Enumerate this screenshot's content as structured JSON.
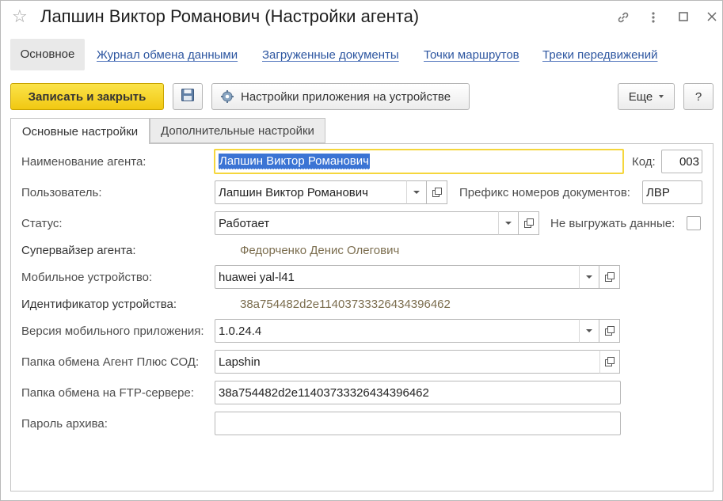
{
  "window": {
    "title": "Лапшин Виктор Романович (Настройки агента)",
    "favorite_icon": "star-icon",
    "link_icon": "link-icon",
    "more_icon": "more-vertical-icon",
    "maximize_icon": "maximize-icon",
    "close_icon": "close-icon"
  },
  "nav": {
    "items": [
      "Основное",
      "Журнал обмена данными",
      "Загруженные документы",
      "Точки маршрутов",
      "Треки передвижений"
    ]
  },
  "toolbar": {
    "save_close_label": "Записать и закрыть",
    "save_icon": "floppy-disk-icon",
    "app_settings_label": "Настройки приложения на устройстве",
    "app_settings_icon": "gear-icon",
    "more_label": "Еще",
    "help_label": "?"
  },
  "tabs": {
    "main": "Основные настройки",
    "extra": "Дополнительные настройки"
  },
  "form": {
    "agent_name_label": "Наименование агента:",
    "agent_name_value": "Лапшин Виктор Романович",
    "code_label": "Код:",
    "code_value": "003",
    "user_label": "Пользователь:",
    "user_value": "Лапшин Виктор Романович",
    "prefix_label": "Префикс номеров документов:",
    "prefix_value": "ЛВР",
    "status_label": "Статус:",
    "status_value": "Работает",
    "no_export_label": "Не выгружать данные:",
    "supervisor_label": "Супервайзер агента:",
    "supervisor_value": "Федорченко Денис Олегович",
    "device_label": "Мобильное устройство:",
    "device_value": "huawei yal-l41",
    "device_id_label": "Идентификатор устройства:",
    "device_id_value": "38a754482d2e11403733326434396462",
    "app_version_label": "Версия мобильного приложения:",
    "app_version_value": "1.0.24.4",
    "exchange_folder_label": "Папка обмена Агент Плюс СОД:",
    "exchange_folder_value": "Lapshin",
    "ftp_folder_label": "Папка обмена на FTP-сервере:",
    "ftp_folder_value": "38a754482d2e11403733326434396462",
    "archive_password_label": "Пароль архива:",
    "archive_password_value": ""
  }
}
